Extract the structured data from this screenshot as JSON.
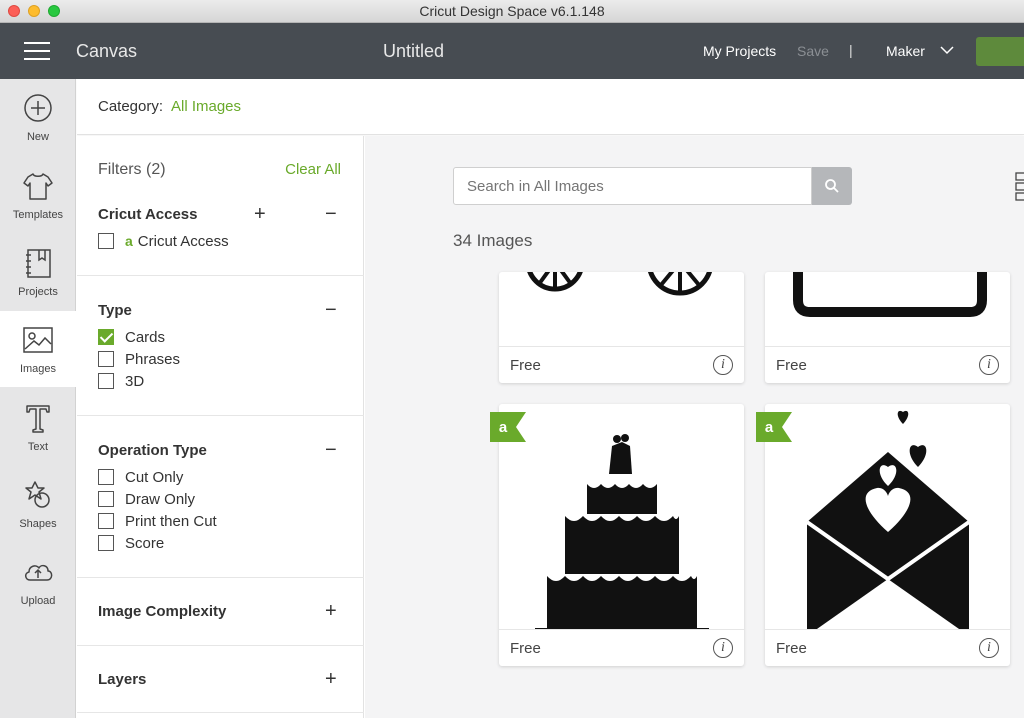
{
  "window": {
    "title": "Cricut Design Space  v6.1.148"
  },
  "header": {
    "section": "Canvas",
    "project_name": "Untitled",
    "my_projects": "My Projects",
    "save": "Save",
    "separator": "|",
    "machine": "Maker"
  },
  "rail": {
    "items": [
      {
        "label": "New",
        "icon": "plus-circle-icon"
      },
      {
        "label": "Templates",
        "icon": "shirt-icon"
      },
      {
        "label": "Projects",
        "icon": "notebook-icon"
      },
      {
        "label": "Images",
        "icon": "image-icon",
        "active": true
      },
      {
        "label": "Text",
        "icon": "text-t-icon"
      },
      {
        "label": "Shapes",
        "icon": "shapes-icon"
      },
      {
        "label": "Upload",
        "icon": "cloud-upload-icon"
      }
    ]
  },
  "category": {
    "label": "Category:",
    "value": "All Images"
  },
  "filters": {
    "heading": "Filters (2)",
    "clear": "Clear All",
    "cricut_access": {
      "title": "Cricut Access",
      "expand": "+",
      "collapse": "−",
      "option": "Cricut Access",
      "badge_letter": "a"
    },
    "type": {
      "title": "Type",
      "collapse": "−",
      "options": [
        {
          "label": "Cards",
          "checked": true
        },
        {
          "label": "Phrases",
          "checked": false
        },
        {
          "label": "3D",
          "checked": false
        }
      ]
    },
    "operation": {
      "title": "Operation Type",
      "collapse": "−",
      "options": [
        {
          "label": "Cut Only",
          "checked": false
        },
        {
          "label": "Draw Only",
          "checked": false
        },
        {
          "label": "Print then Cut",
          "checked": false
        },
        {
          "label": "Score",
          "checked": false
        }
      ]
    },
    "complexity": {
      "title": "Image Complexity",
      "expand": "+"
    },
    "layers": {
      "title": "Layers",
      "expand": "+"
    }
  },
  "search": {
    "placeholder": "Search in All Images"
  },
  "results": {
    "count": "34 Images"
  },
  "cards": [
    {
      "price": "Free",
      "info": "i",
      "image": "bicycle-wheels"
    },
    {
      "price": "Free",
      "info": "i",
      "image": "frame-bottom"
    },
    {
      "price": "Free",
      "info": "i",
      "image": "wedding-cake",
      "badge": "a"
    },
    {
      "price": "Free",
      "info": "i",
      "image": "love-letter-envelope",
      "badge": "a"
    }
  ],
  "colors": {
    "accent": "#6aaa2b",
    "header_bg": "#474c52",
    "rail_bg": "#e6e6e7"
  }
}
